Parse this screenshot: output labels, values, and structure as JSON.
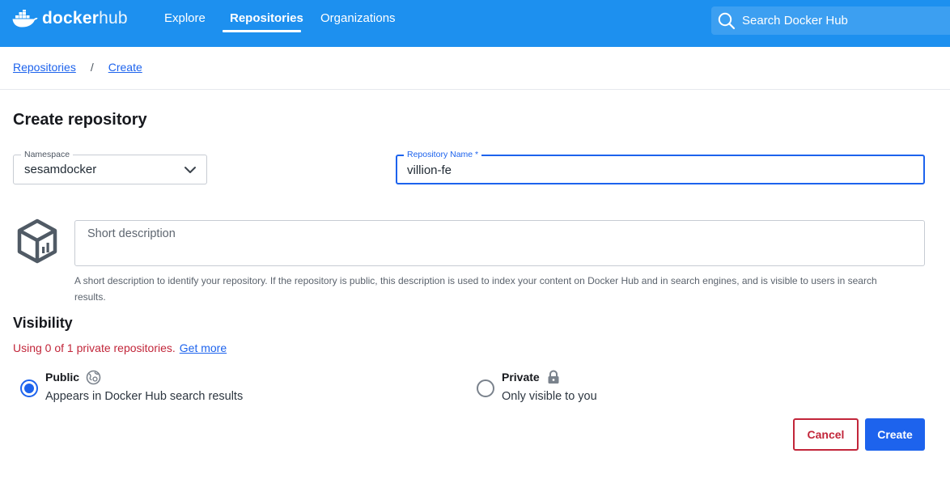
{
  "header": {
    "logo_bold": "docker",
    "logo_light": "hub",
    "nav": [
      {
        "label": "Explore",
        "active": false
      },
      {
        "label": "Repositories",
        "active": true
      },
      {
        "label": "Organizations",
        "active": false
      }
    ],
    "search_placeholder": "Search Docker Hub",
    "background_color": "#1d90ef"
  },
  "breadcrumb": {
    "items": [
      "Repositories",
      "Create"
    ],
    "separator": "/"
  },
  "form": {
    "title": "Create repository",
    "namespace": {
      "label": "Namespace",
      "value": "sesamdocker"
    },
    "repo_name": {
      "label": "Repository Name *",
      "value": "villion-fe",
      "highlight_color": "#fafa1e"
    },
    "description": {
      "placeholder": "Short description",
      "helper": "A short description to identify your repository. If the repository is public, this description is used to index your content on Docker Hub and in search engines, and is visible to users in search results."
    },
    "visibility": {
      "title": "Visibility",
      "usage_text": "Using 0 of 1 private repositories.",
      "get_more": "Get more",
      "options": [
        {
          "label": "Public",
          "description": "Appears in Docker Hub search results",
          "selected": true,
          "icon": "globe-icon"
        },
        {
          "label": "Private",
          "description": "Only visible to you",
          "selected": false,
          "icon": "lock-icon"
        }
      ]
    },
    "actions": {
      "cancel": "Cancel",
      "create": "Create"
    }
  },
  "colors": {
    "accent": "#1d63ed",
    "danger": "#c2263a"
  }
}
